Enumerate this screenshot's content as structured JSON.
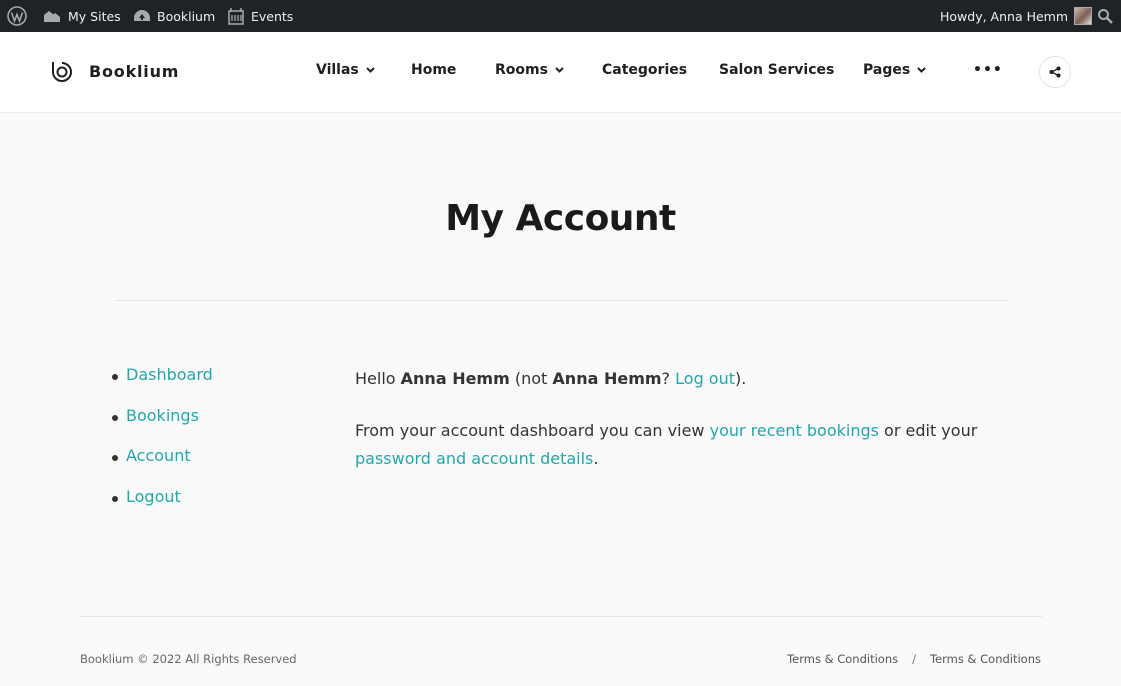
{
  "adminbar": {
    "my_sites": "My Sites",
    "site_name": "Booklium",
    "events": "Events",
    "howdy": "Howdy, Anna Hemm"
  },
  "header": {
    "logo": "Booklium",
    "nav": [
      {
        "label": "Villas",
        "has_dropdown": true
      },
      {
        "label": "Home",
        "has_dropdown": false
      },
      {
        "label": "Rooms",
        "has_dropdown": true
      },
      {
        "label": "Categories",
        "has_dropdown": false
      },
      {
        "label": "Salon Services",
        "has_dropdown": false
      },
      {
        "label": "Pages",
        "has_dropdown": true
      }
    ],
    "more": "•••"
  },
  "main": {
    "title": "My Account",
    "account_nav": [
      "Dashboard",
      "Bookings",
      "Account",
      "Logout"
    ],
    "greeting": {
      "hello": "Hello",
      "user": "Anna Hemm",
      "not": "(not",
      "user2": "Anna Hemm",
      "q": "?",
      "logout_link": "Log out",
      "close": ")."
    },
    "dashboard": {
      "text1": "From your account dashboard you can view",
      "link1": "your recent bookings",
      "text2": "or edit your",
      "link2": "password and account details",
      "end": "."
    }
  },
  "footer": {
    "copyright": "Booklium © 2022 All Rights Reserved",
    "link1": "Terms & Conditions",
    "separator": "/",
    "link2": "Terms & Conditions"
  },
  "colors": {
    "accent": "#1fa8ad",
    "adminbar_bg": "#1d2327"
  }
}
